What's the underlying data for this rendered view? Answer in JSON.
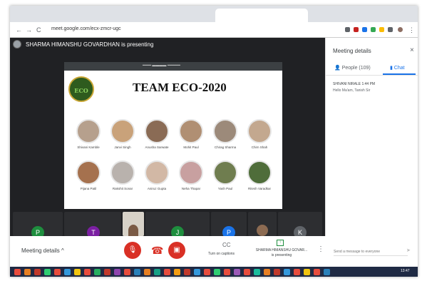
{
  "browser": {
    "url": "meet.google.com/ecx-zmcr-ugc",
    "nav_back": "←",
    "nav_forward": "→",
    "nav_reload": "C",
    "lock": "🔒"
  },
  "meet": {
    "presenting_text": "SHARMA HIMANSHU GOVARDHAN is presenting",
    "slide": {
      "logo_text": "ECO",
      "title": "TEAM ECO-2020",
      "members": [
        {
          "name": "Shivani Kamble"
        },
        {
          "name": "Janvi Singh"
        },
        {
          "name": "Anusha Sarwate"
        },
        {
          "name": "Mohit Paul"
        },
        {
          "name": "Chirag Sharma"
        },
        {
          "name": "Chirn Shah"
        },
        {
          "name": "Pijana Patil"
        },
        {
          "name": "Rakshit Sonar"
        },
        {
          "name": "Aniruz Gupta"
        },
        {
          "name": "Neha Thapar"
        },
        {
          "name": "Yash Paul"
        },
        {
          "name": "Ritesh Varadkar"
        }
      ]
    },
    "tiles": [
      {
        "initial": "P",
        "color": "#1e8e3e"
      },
      {
        "initial": "T",
        "color": "#7b1fa2"
      },
      {
        "initial": "J",
        "color": "#1e8e3e"
      },
      {
        "initial": "P",
        "color": "#1a73e8"
      },
      {
        "initial": "K",
        "color": "#5f6368"
      }
    ]
  },
  "panel": {
    "title": "Meeting details",
    "close": "×",
    "people_tab": "People (109)",
    "chat_tab": "Chat",
    "message_sender": "SHIVANI NIRALE 1:44 PM",
    "message_text": "Hello Ma'am, Tanish Sir"
  },
  "bottom": {
    "meeting_details": "Meeting details",
    "chevron": "^",
    "captions_icon": "CC",
    "captions_label": "Turn on captions",
    "present_label_line1": "SHARMA HIMANSHU GOVAR...",
    "present_label_line2": "is presenting",
    "more": "⋮",
    "chat_placeholder": "Send a message to everyone",
    "send": "➤"
  },
  "taskbar": {
    "clock": "13:47"
  },
  "colors": {
    "meet_bg": "#202124",
    "accent_blue": "#1a73e8",
    "danger_red": "#d93025",
    "present_green": "#1e8e3e"
  }
}
